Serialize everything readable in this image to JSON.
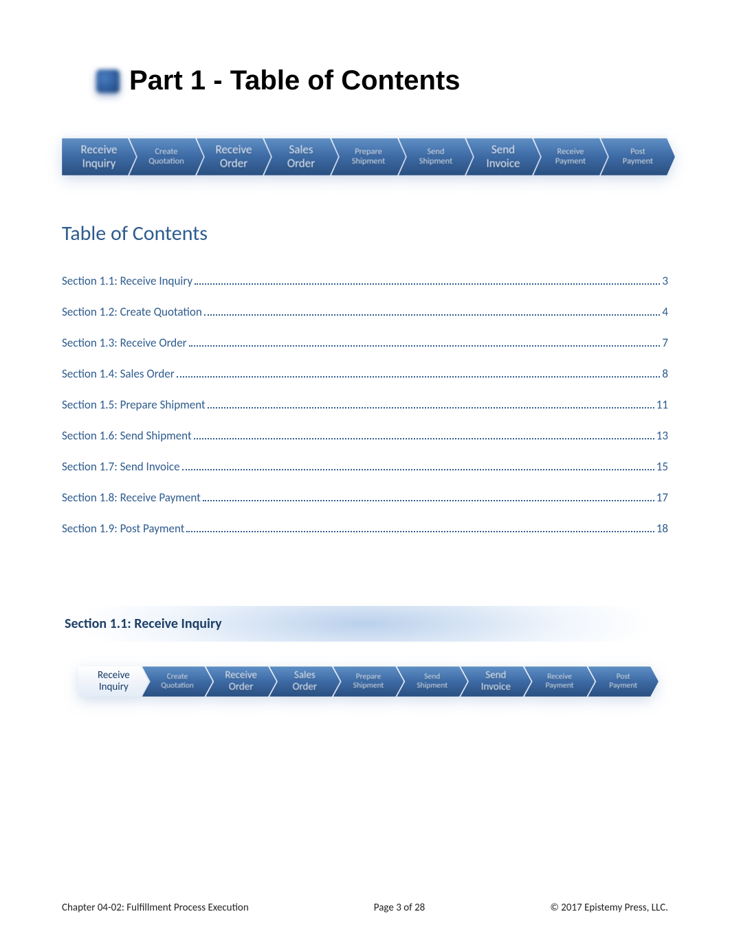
{
  "title": "Part 1 - Table of Contents",
  "process_steps": [
    {
      "l1": "Receive",
      "l2": "Inquiry",
      "size": "big"
    },
    {
      "l1": "Create",
      "l2": "Quotation",
      "size": "small"
    },
    {
      "l1": "Receive",
      "l2": "Order",
      "size": "big"
    },
    {
      "l1": "Sales",
      "l2": "Order",
      "size": "big"
    },
    {
      "l1": "Prepare",
      "l2": "Shipment",
      "size": "small"
    },
    {
      "l1": "Send",
      "l2": "Shipment",
      "size": "small"
    },
    {
      "l1": "Send",
      "l2": "Invoice",
      "size": "big"
    },
    {
      "l1": "Receive",
      "l2": "Payment",
      "size": "small"
    },
    {
      "l1": "Post",
      "l2": "Payment",
      "size": "small"
    }
  ],
  "toc_heading": "Table of Contents",
  "toc": [
    {
      "label": "Section 1.1: Receive Inquiry",
      "page": "3"
    },
    {
      "label": "Section 1.2: Create Quotation",
      "page": "4"
    },
    {
      "label": "Section 1.3: Receive Order",
      "page": "7"
    },
    {
      "label": "Section 1.4: Sales Order",
      "page": "8"
    },
    {
      "label": "Section 1.5: Prepare Shipment",
      "page": "11"
    },
    {
      "label": "Section 1.6: Send Shipment",
      "page": "13"
    },
    {
      "label": "Section 1.7: Send Invoice",
      "page": "15"
    },
    {
      "label": "Section 1.8: Receive Payment",
      "page": "17"
    },
    {
      "label": "Section 1.9: Post Payment",
      "page": "18"
    }
  ],
  "section_heading": "Section 1.1: Receive Inquiry",
  "section_active_step": 0,
  "footer": {
    "left": "Chapter 04-02: Fulfillment Process Execution",
    "center": "Page 3 of 28",
    "right": "© 2017 Epistemy Press, LLC."
  }
}
